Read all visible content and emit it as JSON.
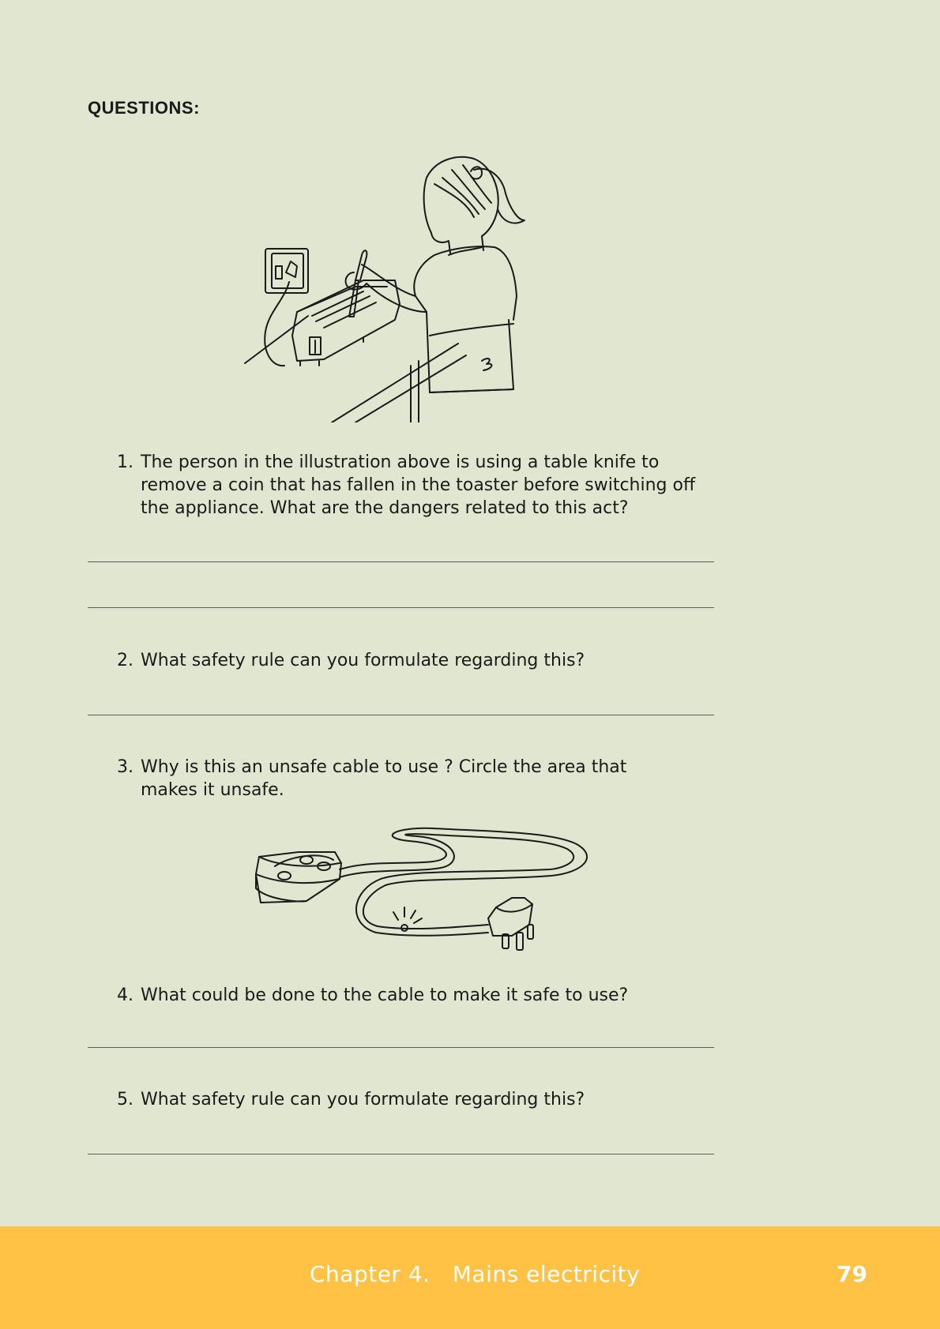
{
  "heading": "QUESTIONS:",
  "questions": [
    {
      "number": "1.",
      "text": "The person in the illustration above is using a table knife to remove a coin that has fallen in the toaster before switching off the appliance. What are the dangers related to this act?"
    },
    {
      "number": "2.",
      "text": "What safety rule can you formulate regarding this?"
    },
    {
      "number": "3.",
      "text": "Why is this an unsafe cable to use ? Circle the area that makes it unsafe."
    },
    {
      "number": "4.",
      "text": "What could be done to the cable to make it safe to use?"
    },
    {
      "number": "5.",
      "text": "What safety rule can you formulate regarding this?"
    }
  ],
  "footer": {
    "chapter": "Chapter 4.   Mains electricity",
    "page_number": "79",
    "color": "#ffc244"
  },
  "colors": {
    "page_background": "#e1e6d0"
  },
  "illustrations": [
    {
      "icon": "girl-toaster-illustration"
    },
    {
      "icon": "damaged-cable-illustration"
    }
  ]
}
